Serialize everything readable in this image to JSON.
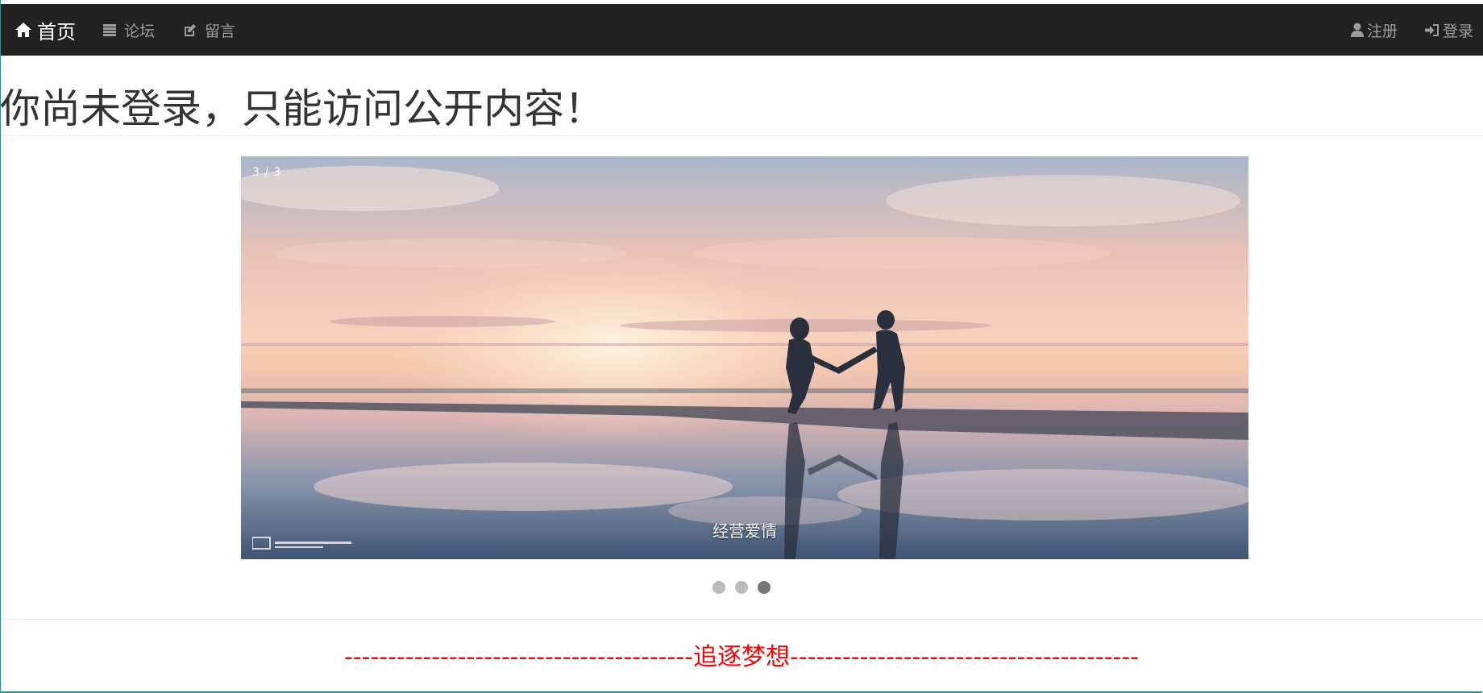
{
  "navbar": {
    "brand_label": "首页",
    "items": [
      {
        "label": "论坛",
        "icon": "list-icon"
      },
      {
        "label": "留言",
        "icon": "edit-icon"
      }
    ],
    "right_items": [
      {
        "label": "注册",
        "icon": "user-icon"
      },
      {
        "label": "登录",
        "icon": "login-icon"
      }
    ]
  },
  "hero": {
    "title": "你尚未登录，只能访问公开内容！"
  },
  "carousel": {
    "counter": "3 / 3",
    "caption": "经营爱情",
    "total_slides": 3,
    "active_slide": 3
  },
  "footer": {
    "text": "----------------------------------------追逐梦想----------------------------------------"
  },
  "colors": {
    "navbar_bg": "#222222",
    "nav_text": "#9d9d9d",
    "footer_text": "#ff0000",
    "dot_inactive": "#bbbbbb",
    "dot_active": "#777777"
  }
}
